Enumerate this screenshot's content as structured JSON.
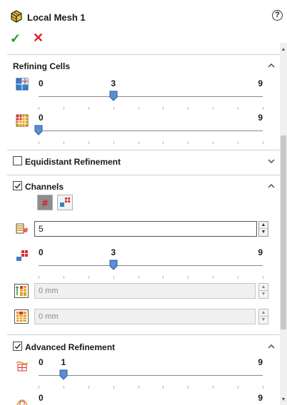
{
  "header": {
    "title": "Local Mesh 1",
    "help_label": "?",
    "ok_label": "✓",
    "cancel_label": "✕"
  },
  "sections": {
    "refining_cells": {
      "title": "Refining Cells",
      "slider1": {
        "min": "0",
        "max": "9",
        "value": "3",
        "value_num": 3,
        "max_num": 9
      },
      "slider2": {
        "min": "0",
        "max": "9",
        "value_num": 0,
        "max_num": 9
      }
    },
    "equidistant": {
      "title": "Equidistant Refinement",
      "checked": false
    },
    "channels": {
      "title": "Channels",
      "checked": true,
      "count_value": "5",
      "slider": {
        "min": "0",
        "max": "9",
        "value": "3",
        "value_num": 3,
        "max_num": 9
      },
      "min_height": "0 mm",
      "max_height": "0 mm"
    },
    "advanced": {
      "title": "Advanced Refinement",
      "checked": true,
      "slider1": {
        "min": "0",
        "max": "9",
        "value": "1",
        "value_num": 1,
        "max_num": 9
      },
      "slider2": {
        "min": "0",
        "max": "9"
      }
    }
  },
  "colors": {
    "ok": "#1e9e1e",
    "cancel": "#e02020",
    "thumb": "#5b8fd4"
  }
}
